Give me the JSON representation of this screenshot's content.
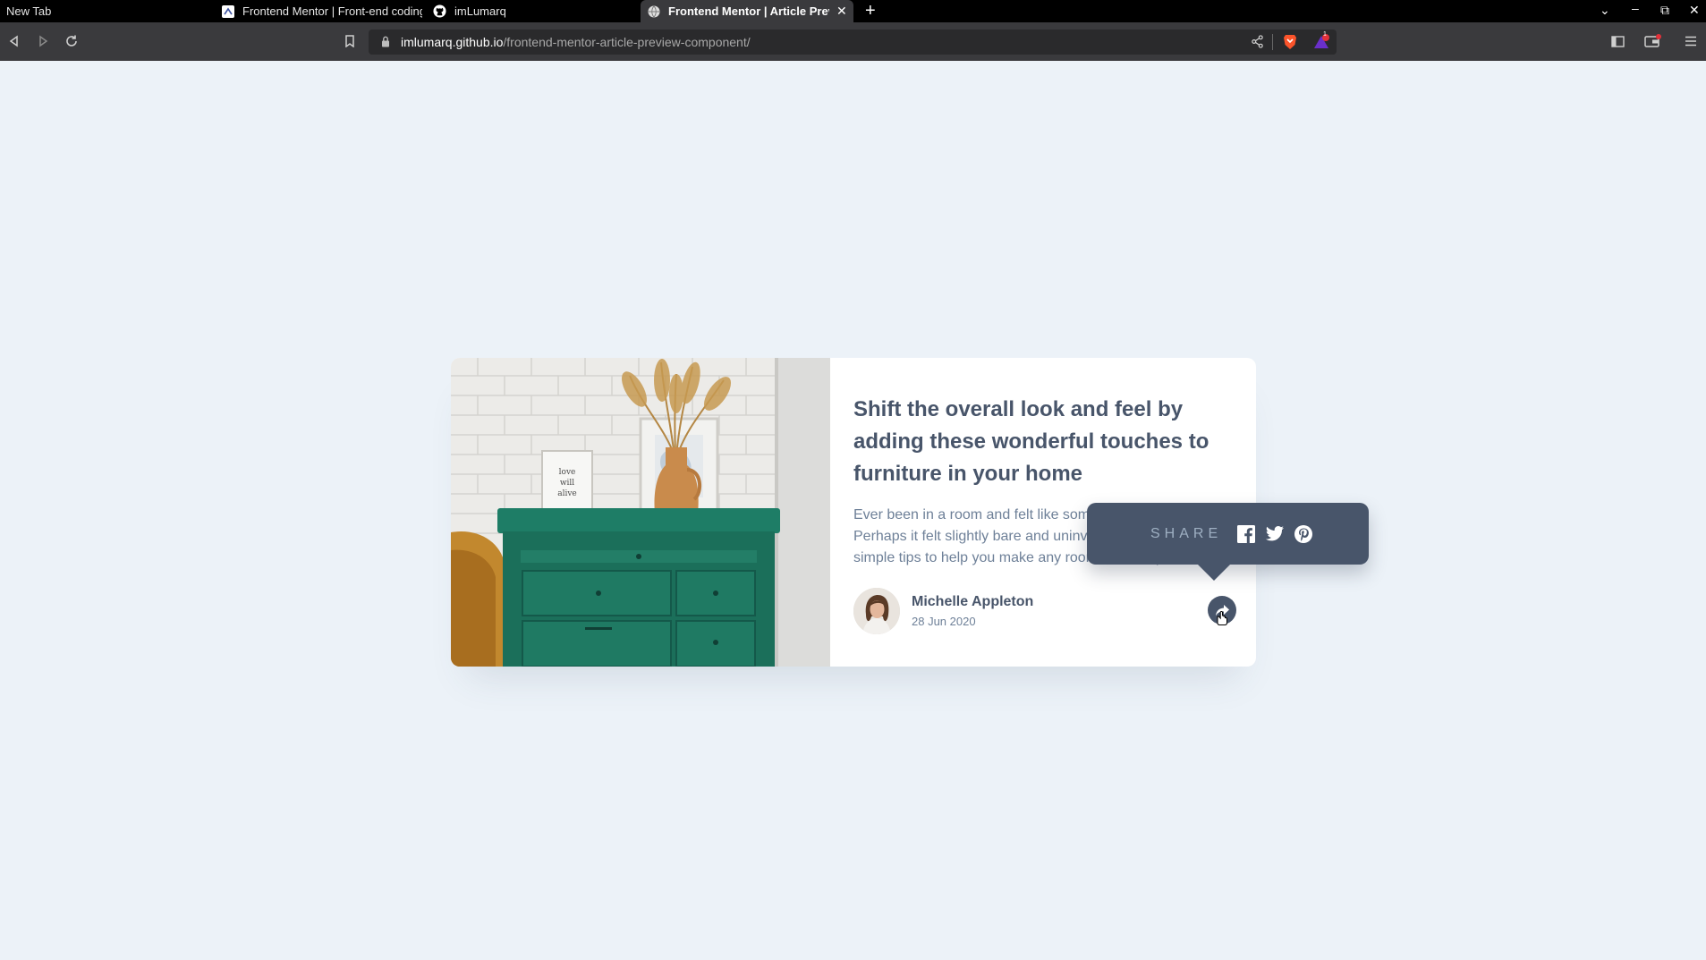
{
  "browser": {
    "tabs": [
      {
        "title": "New Tab",
        "active": false
      },
      {
        "title": "Frontend Mentor | Front-end coding challenges using a real-life workflow",
        "active": false
      },
      {
        "title": "imLumarq",
        "active": false
      },
      {
        "title": "Frontend Mentor | Article Preview Component",
        "active": true
      }
    ],
    "url_host": "imlumarq.github.io",
    "url_path": "/frontend-mentor-article-preview-component/",
    "brave_badge": "1"
  },
  "article": {
    "title": "Shift the overall look and feel by adding these wonderful touches to furniture in your home",
    "excerpt": "Ever been in a room and felt like something was missing? Perhaps it felt slightly bare and uninviting. I’ve got some simple tips to help you make any room feel complete.",
    "author": {
      "name": "Michelle Appleton",
      "date": "28 Jun 2020"
    },
    "photo_art_text": "love will keep us alive"
  },
  "share": {
    "label": "SHARE",
    "networks": [
      "facebook-icon",
      "twitter-icon",
      "pinterest-icon"
    ]
  },
  "colors": {
    "page_bg": "#ecf2f8",
    "dark_blue": "#48556a",
    "grayish_blue": "#6e8098",
    "light_grayish_blue": "#9eafc2"
  }
}
